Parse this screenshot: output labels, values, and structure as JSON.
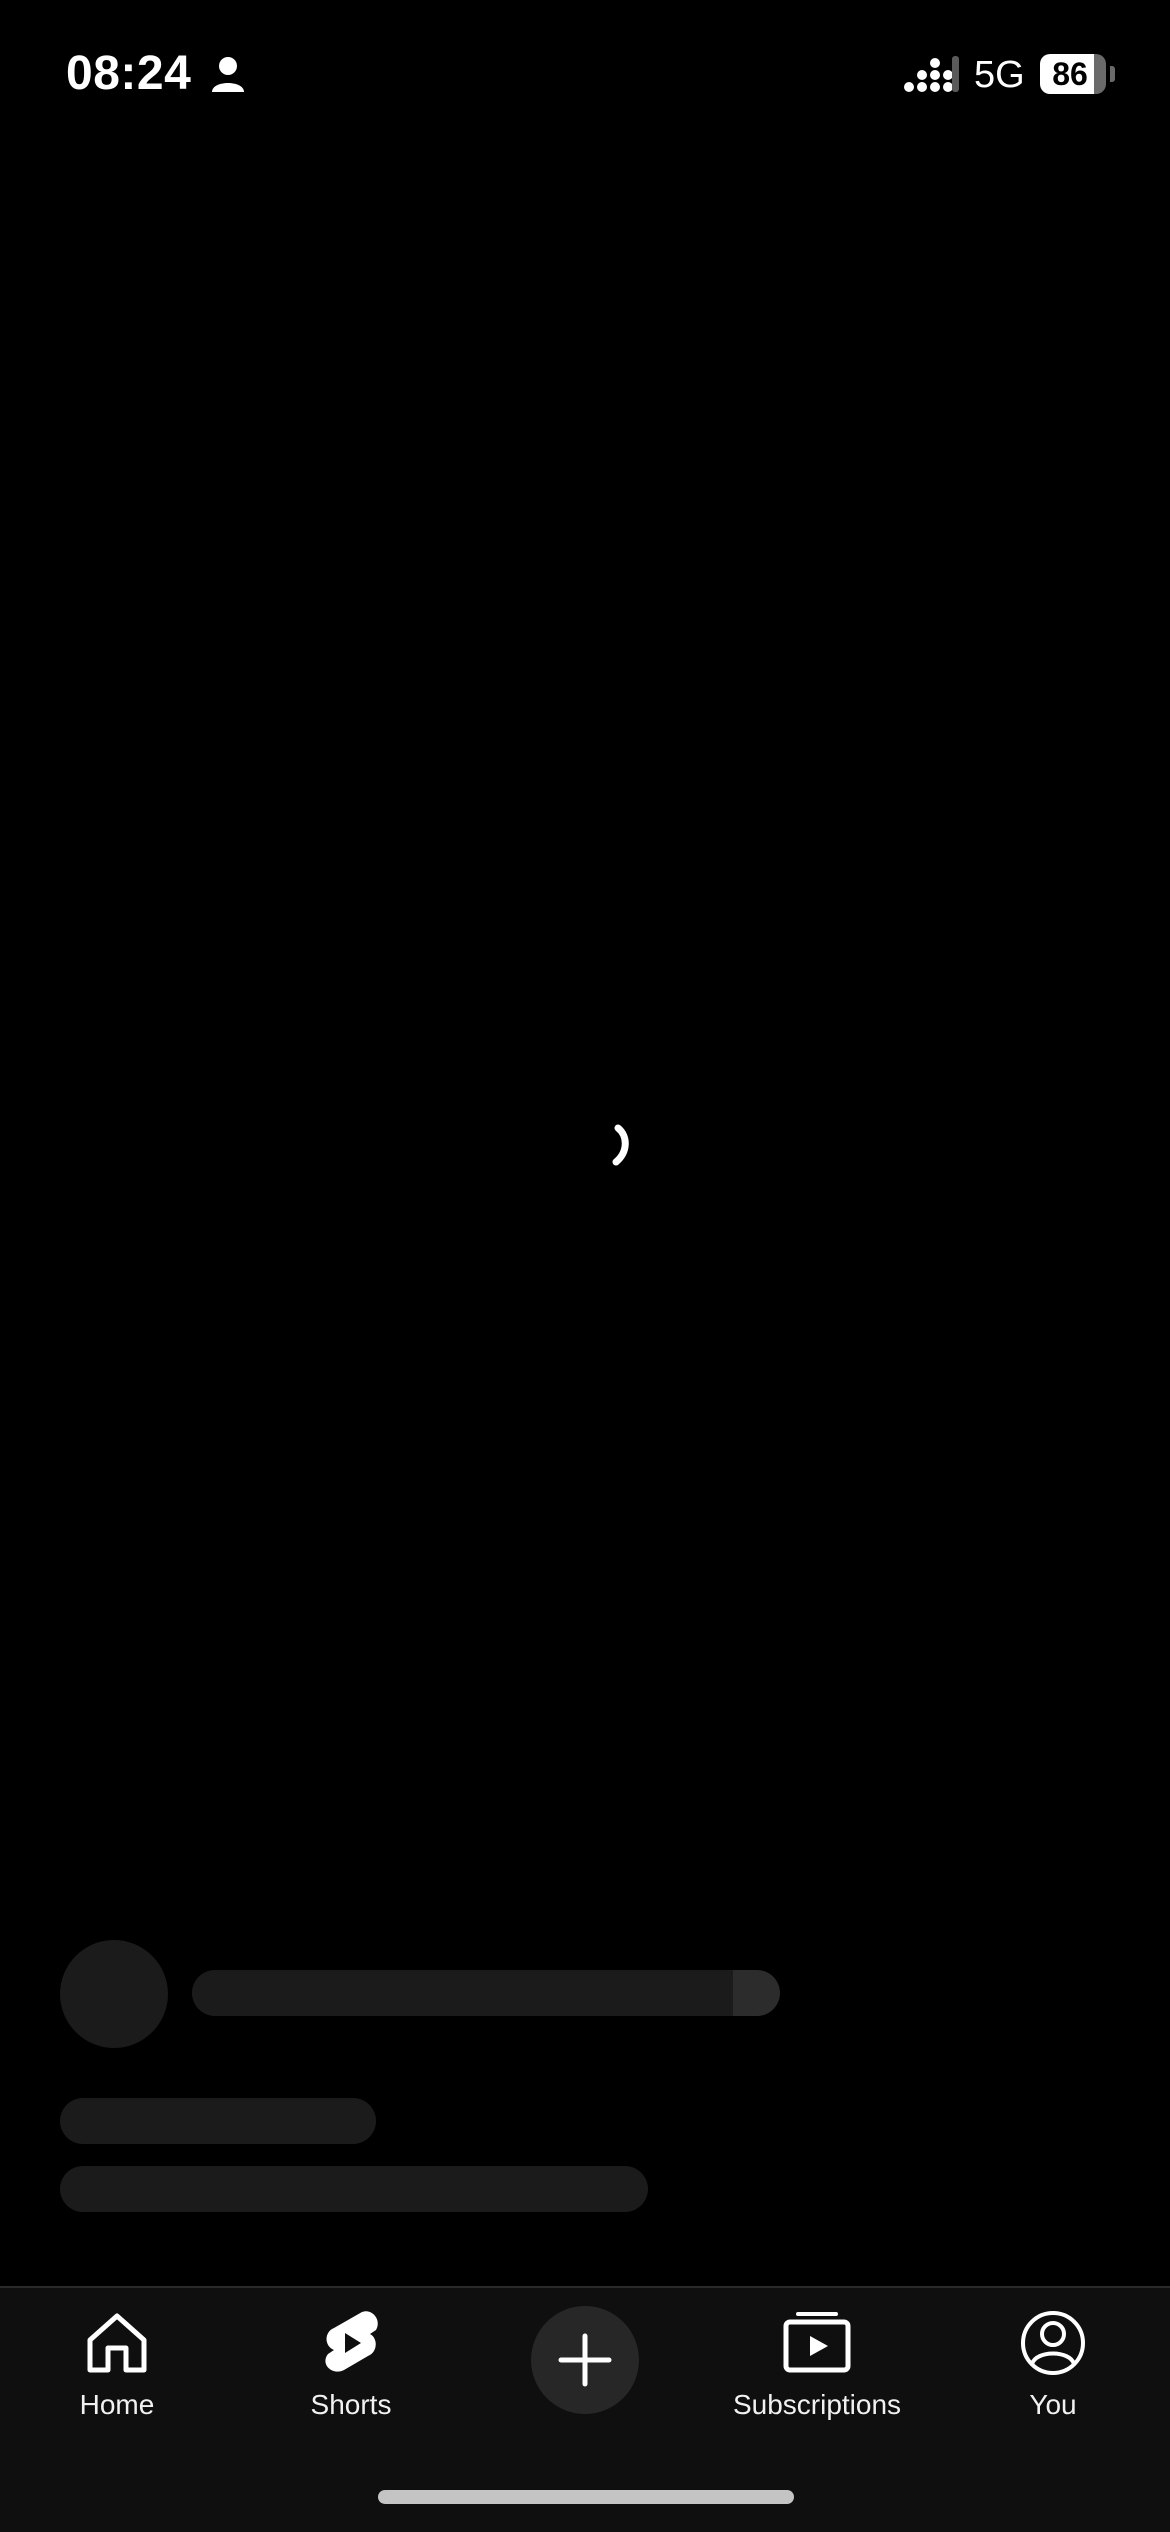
{
  "status_bar": {
    "time": "08:24",
    "network": "5G",
    "battery": "86",
    "icons": [
      "person-icon",
      "signal-icon",
      "battery-icon"
    ]
  },
  "loading": {
    "icon": "loading-spinner-icon"
  },
  "colors": {
    "background": "#000000",
    "nav_background": "#0f0f0f",
    "skeleton": "#1b1b1b",
    "create_button": "#272727",
    "text": "#f1f1f1"
  },
  "bottom_nav": {
    "items": [
      {
        "label": "Home",
        "icon": "home-icon"
      },
      {
        "label": "Shorts",
        "icon": "shorts-icon"
      },
      {
        "label": "",
        "icon": "plus-icon"
      },
      {
        "label": "Subscriptions",
        "icon": "subscriptions-icon"
      },
      {
        "label": "You",
        "icon": "account-icon"
      }
    ]
  }
}
